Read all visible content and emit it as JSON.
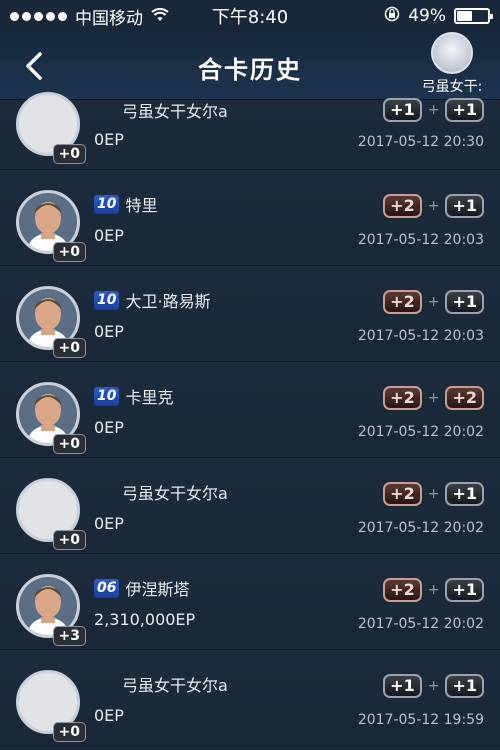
{
  "status": {
    "carrier": "中国移动",
    "time": "下午8:40",
    "battery": "49%",
    "battery_fraction": 0.49
  },
  "nav": {
    "title": "合卡历史",
    "username": "弓虽女干:"
  },
  "rows": [
    {
      "name": "弓虽女干女尔a",
      "tag": "",
      "ep": "0EP",
      "date": "2017-05-12 20:30",
      "level": "+0",
      "card1": "+1",
      "card2": "+1",
      "avatar": "blank"
    },
    {
      "name": "特里",
      "tag": "10",
      "ep": "0EP",
      "date": "2017-05-12 20:03",
      "level": "+0",
      "card1": "+2",
      "card2": "+1",
      "avatar": "player"
    },
    {
      "name": "大卫·路易斯",
      "tag": "10",
      "ep": "0EP",
      "date": "2017-05-12 20:03",
      "level": "+0",
      "card1": "+2",
      "card2": "+1",
      "avatar": "player"
    },
    {
      "name": "卡里克",
      "tag": "10",
      "ep": "0EP",
      "date": "2017-05-12 20:02",
      "level": "+0",
      "card1": "+2",
      "card2": "+2",
      "avatar": "player"
    },
    {
      "name": "弓虽女干女尔a",
      "tag": "",
      "ep": "0EP",
      "date": "2017-05-12 20:02",
      "level": "+0",
      "card1": "+2",
      "card2": "+1",
      "avatar": "blank"
    },
    {
      "name": "伊涅斯塔",
      "tag": "06",
      "ep": "2,310,000EP",
      "date": "2017-05-12 20:02",
      "level": "+3",
      "card1": "+2",
      "card2": "+1",
      "avatar": "player"
    },
    {
      "name": "弓虽女干女尔a",
      "tag": "",
      "ep": "0EP",
      "date": "2017-05-12 19:59",
      "level": "+0",
      "card1": "+1",
      "card2": "+1",
      "avatar": "blank"
    }
  ]
}
